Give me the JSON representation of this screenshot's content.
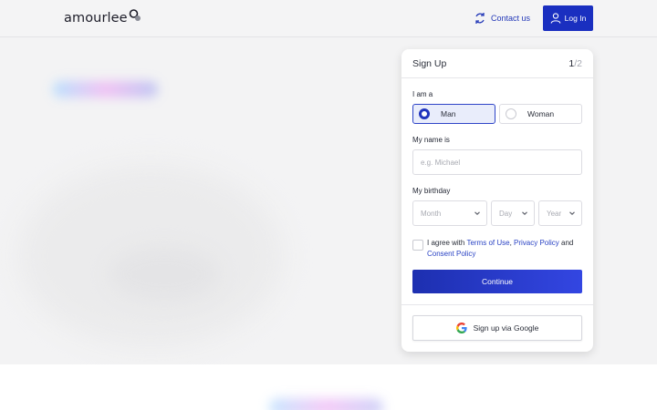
{
  "header": {
    "logo_text": "amourlee",
    "contact_label": "Contact us",
    "login_label": "Log In"
  },
  "signup": {
    "title": "Sign Up",
    "step_current": "1",
    "step_total": "/2",
    "gender_label": "I am a",
    "gender_options": [
      "Man",
      "Woman"
    ],
    "gender_selected": "Man",
    "name_label": "My name is",
    "name_placeholder": "e.g. Michael",
    "name_value": "",
    "birthday_label": "My birthday",
    "month_placeholder": "Month",
    "day_placeholder": "Day",
    "year_placeholder": "Year",
    "agree_prefix": "I agree with ",
    "terms_link": "Terms of Use",
    "comma": ", ",
    "privacy_link": "Privacy Policy",
    "and_text": " and ",
    "consent_link": "Consent Policy",
    "agree_checked": false,
    "continue_label": "Continue",
    "google_label": "Sign up via Google"
  },
  "colors": {
    "brand_blue": "#1a2fc0",
    "link_blue": "#2a43c4",
    "selected_bg": "#e9edfb"
  }
}
